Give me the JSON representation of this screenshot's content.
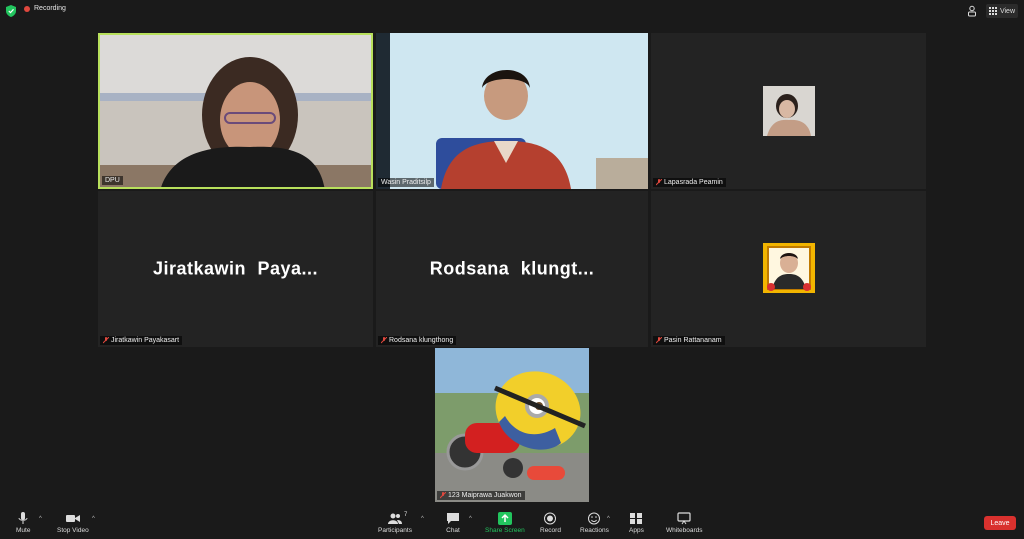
{
  "top_bar": {
    "recording_label": "Recording",
    "view_label": "View",
    "shield_icon": "security-shield-icon",
    "accent": "#22c55e"
  },
  "tiles": [
    {
      "name": "DPU",
      "muted": false,
      "active": true
    },
    {
      "name": "Wasin Praditsilp",
      "muted": false,
      "active": false
    },
    {
      "name": "Lapasrada Peamin",
      "muted": true
    },
    {
      "name": "Jiratkawin Payakasart",
      "display_name": "Jiratkawin  Paya...",
      "muted": true
    },
    {
      "name": "Rodsana klungthong",
      "display_name": "Rodsana  klungt...",
      "muted": true
    },
    {
      "name": "Pasin Rattananam",
      "muted": true
    },
    {
      "name": "123 Maiprawa Juakwon",
      "muted": true
    }
  ],
  "toolbar": {
    "mute": "Mute",
    "stop_video": "Stop Video",
    "participants": "Participants",
    "participant_count": "7",
    "chat": "Chat",
    "share_screen": "Share Screen",
    "record": "Record",
    "reactions": "Reactions",
    "apps": "Apps",
    "whiteboards": "Whiteboards",
    "leave": "Leave",
    "leave_color": "#d9312e"
  }
}
